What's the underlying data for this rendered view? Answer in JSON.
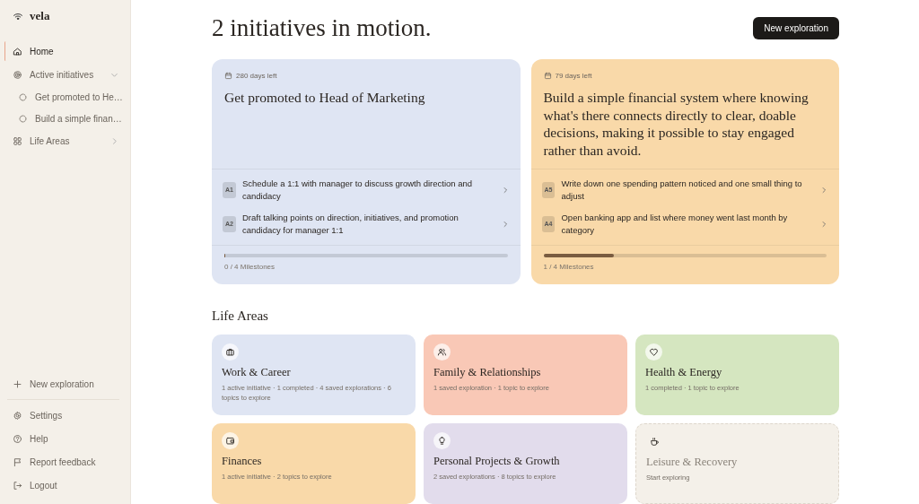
{
  "sidebar": {
    "brand": "vela",
    "nav": [
      {
        "label": "Home",
        "selected": true
      },
      {
        "label": "Active initiatives",
        "selected": false,
        "expanded": true,
        "children": [
          {
            "label": "Get promoted to He…",
            "selected": false
          },
          {
            "label": "Build a simple finan…",
            "selected": false
          }
        ]
      },
      {
        "label": "Life Areas",
        "selected": false,
        "expanded": false
      }
    ],
    "new_action": "New exploration",
    "footer": [
      "Settings",
      "Help",
      "Report feedback",
      "Logout"
    ]
  },
  "main": {
    "heading": "2 initiatives in motion.",
    "new_button": "New exploration",
    "initiatives": [
      {
        "color": "#dfe5f3",
        "days_left": "280 days left",
        "title": "Get promoted to Head of Marketing",
        "actions": [
          {
            "code": "A1",
            "text": "Schedule a 1:1 with manager to discuss growth direction and candidacy"
          },
          {
            "code": "A2",
            "text": "Draft talking points on direction, initiatives, and promotion candidacy for manager 1:1"
          }
        ],
        "level": 0,
        "milestones": "0 / 4 Milestones"
      },
      {
        "color": "#f9d9a9",
        "days_left": "79 days left",
        "title": "Build a simple financial system where knowing what's there connects directly to clear, doable decisions, making it possible to stay engaged rather than avoid.",
        "actions": [
          {
            "code": "A5",
            "text": "Write down one spending pattern noticed and one small thing to adjust"
          },
          {
            "code": "A4",
            "text": "Open banking app and list where money went last month by category"
          }
        ],
        "level": 0.25,
        "milestones": "1 / 4 Milestones"
      }
    ],
    "areas_heading": "Life Areas",
    "areas": [
      {
        "kind": "area",
        "color": "#dfe5f3",
        "name": "Work & Career",
        "meta": "1 active initiative · 1 completed · 4 saved explorations · 6 topics to explore"
      },
      {
        "kind": "area",
        "color": "#f9c8b6",
        "name": "Family & Relationships",
        "meta": "1 saved exploration · 1 topic to explore"
      },
      {
        "kind": "area",
        "color": "#d5e6c0",
        "name": "Health & Energy",
        "meta": "1 completed · 1 topic to explore"
      },
      {
        "kind": "area",
        "color": "#f9d9a9",
        "name": "Finances",
        "meta": "1 active initiative · 2 topics to explore"
      },
      {
        "kind": "area",
        "color": "#e2dcec",
        "name": "Personal Projects & Growth",
        "meta": "2 saved explorations · 8 topics to explore"
      },
      {
        "kind": "empty",
        "color": "#f4f0e9",
        "name": "Leisure & Recovery",
        "meta": "Start exploring"
      }
    ]
  }
}
